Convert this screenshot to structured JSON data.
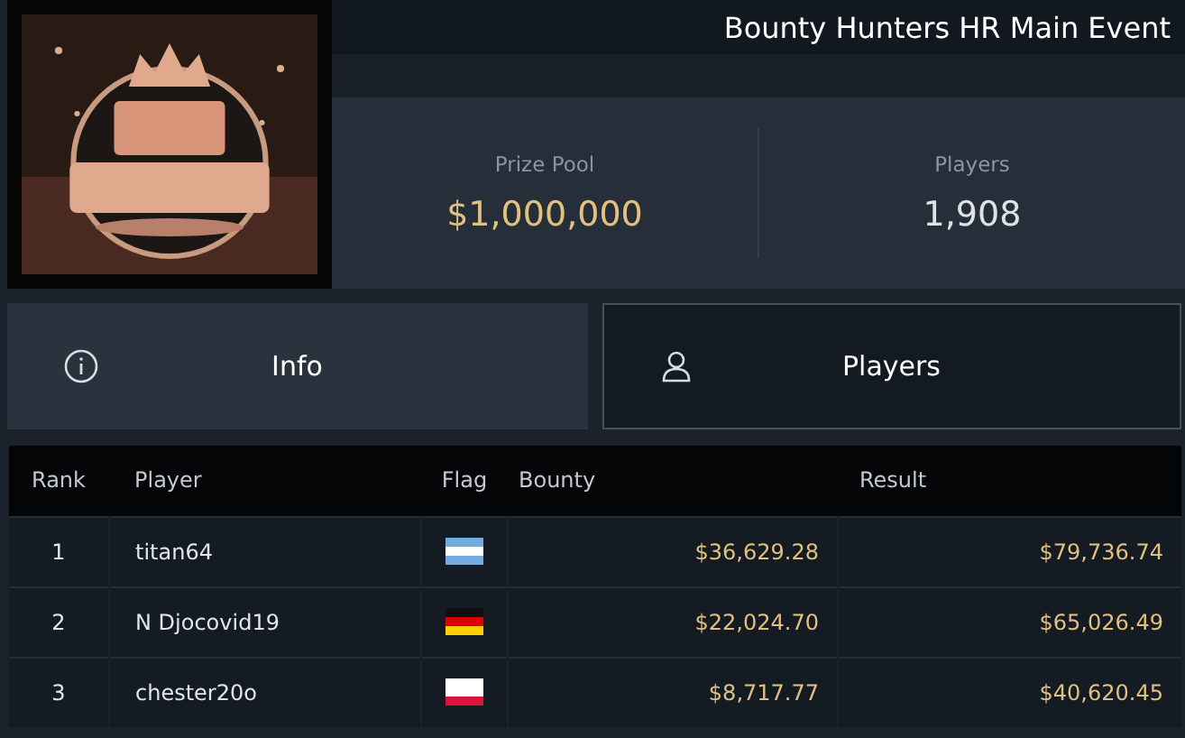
{
  "header": {
    "title": "Bounty Hunters HR Main Event"
  },
  "stats": [
    {
      "label": "Prize Pool",
      "value": "$1,000,000",
      "kind": "money"
    },
    {
      "label": "Players",
      "value": "1,908",
      "kind": "count"
    }
  ],
  "tabs": [
    {
      "label": "Info",
      "kind": "info",
      "selected": false
    },
    {
      "label": "Players",
      "kind": "people",
      "selected": true
    }
  ],
  "table": {
    "columns": [
      "Rank",
      "Player",
      "Flag",
      "Bounty",
      "Result"
    ],
    "rows": [
      {
        "rank": "1",
        "player": "titan64",
        "flag": [
          {
            "color": "#74acdf"
          },
          {
            "color": "#ffffff"
          },
          {
            "color": "#74acdf"
          }
        ],
        "bounty": "$36,629.28",
        "result": "$79,736.74"
      },
      {
        "rank": "2",
        "player": "N Djocovid19",
        "flag": [
          {
            "color": "#111111"
          },
          {
            "color": "#dd0000"
          },
          {
            "color": "#ffce00"
          }
        ],
        "bounty": "$22,024.70",
        "result": "$65,026.49"
      },
      {
        "rank": "3",
        "player": "chester20o",
        "flag": [
          {
            "color": "#ffffff"
          },
          {
            "color": "#ffffff"
          },
          {
            "color": "#dc143c"
          }
        ],
        "bounty": "$8,717.77",
        "result": "$40,620.45"
      }
    ]
  }
}
